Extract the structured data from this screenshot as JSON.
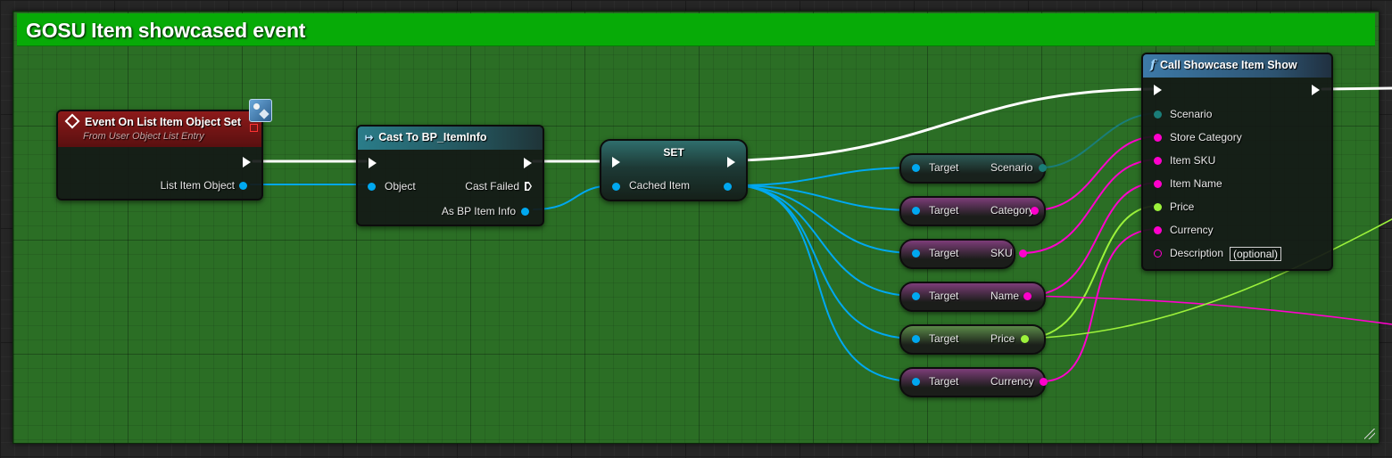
{
  "comment": {
    "title": "GOSU Item showcased event",
    "color": "#07ab07"
  },
  "event_node": {
    "title": "Event On List Item Object Set",
    "subtitle": "From User Object List Entry",
    "output_pin": "List Item Object"
  },
  "cast_node": {
    "title": "Cast To BP_ItemInfo",
    "input_pin": "Object",
    "cast_failed_pin": "Cast Failed",
    "output_pin": "As BP Item Info"
  },
  "set_node": {
    "title": "SET",
    "pin": "Cached Item"
  },
  "getters": [
    {
      "target": "Target",
      "output": "Scenario",
      "color": "#1a7d78"
    },
    {
      "target": "Target",
      "output": "Category",
      "color": "#ff00cc"
    },
    {
      "target": "Target",
      "output": "SKU",
      "color": "#ff00cc"
    },
    {
      "target": "Target",
      "output": "Name",
      "color": "#ff00cc"
    },
    {
      "target": "Target",
      "output": "Price",
      "color": "#9cf23b"
    },
    {
      "target": "Target",
      "output": "Currency",
      "color": "#ff00cc"
    }
  ],
  "call_node": {
    "title": "Call Showcase Item Show",
    "pins": [
      {
        "label": "Scenario",
        "color": "#1a7d78"
      },
      {
        "label": "Store Category",
        "color": "#ff00cc"
      },
      {
        "label": "Item SKU",
        "color": "#ff00cc"
      },
      {
        "label": "Item Name",
        "color": "#ff00cc"
      },
      {
        "label": "Price",
        "color": "#9cf23b"
      },
      {
        "label": "Currency",
        "color": "#ff00cc"
      },
      {
        "label": "Description",
        "color": "#ff00cc"
      }
    ],
    "optional_label": "(optional)"
  },
  "colors": {
    "object_pin": "#00a8f0",
    "string_pin": "#ff00cc",
    "float_pin": "#9cf23b",
    "struct_pin": "#1a7d78",
    "exec_wire": "#ffffff"
  },
  "icons": {
    "event": "event-diamond-icon",
    "cast": "cast-arrow-icon",
    "function": "function-f-icon",
    "widget": "widget-blueprint-icon"
  }
}
